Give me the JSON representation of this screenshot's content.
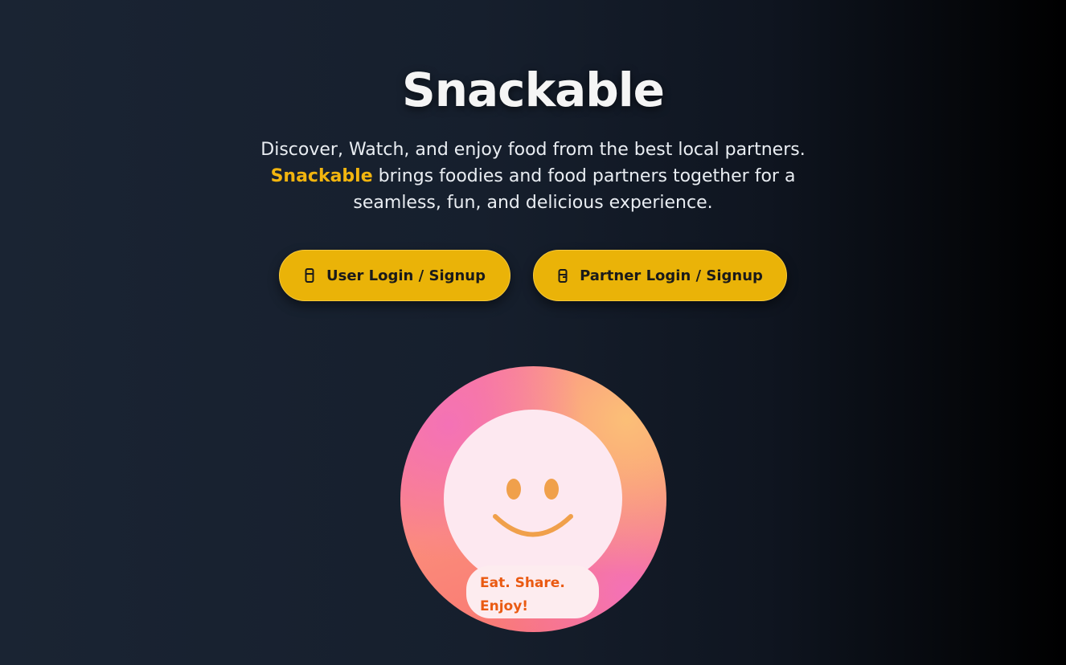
{
  "hero": {
    "title": "Snackable",
    "tagline_before": "Discover, Watch, and enjoy food from the best local partners. ",
    "tagline_highlight": "Snackable",
    "tagline_after": " brings foodies and food partners together for a seamless, fun, and delicious experience."
  },
  "actions": {
    "user_label": "User Login / Signup",
    "user_icon": "user-device-icon",
    "partner_label": "Partner Login / Signup",
    "partner_icon": "partner-store-icon"
  },
  "illustration": {
    "icon": "smiley-face-icon",
    "badge_line1": "Eat. Share.",
    "badge_line2": "Enjoy!"
  },
  "colors": {
    "accent": "#eab308",
    "highlight": "#f2b50f",
    "badge_text": "#ea5a12",
    "smile": "#f0a04b"
  }
}
